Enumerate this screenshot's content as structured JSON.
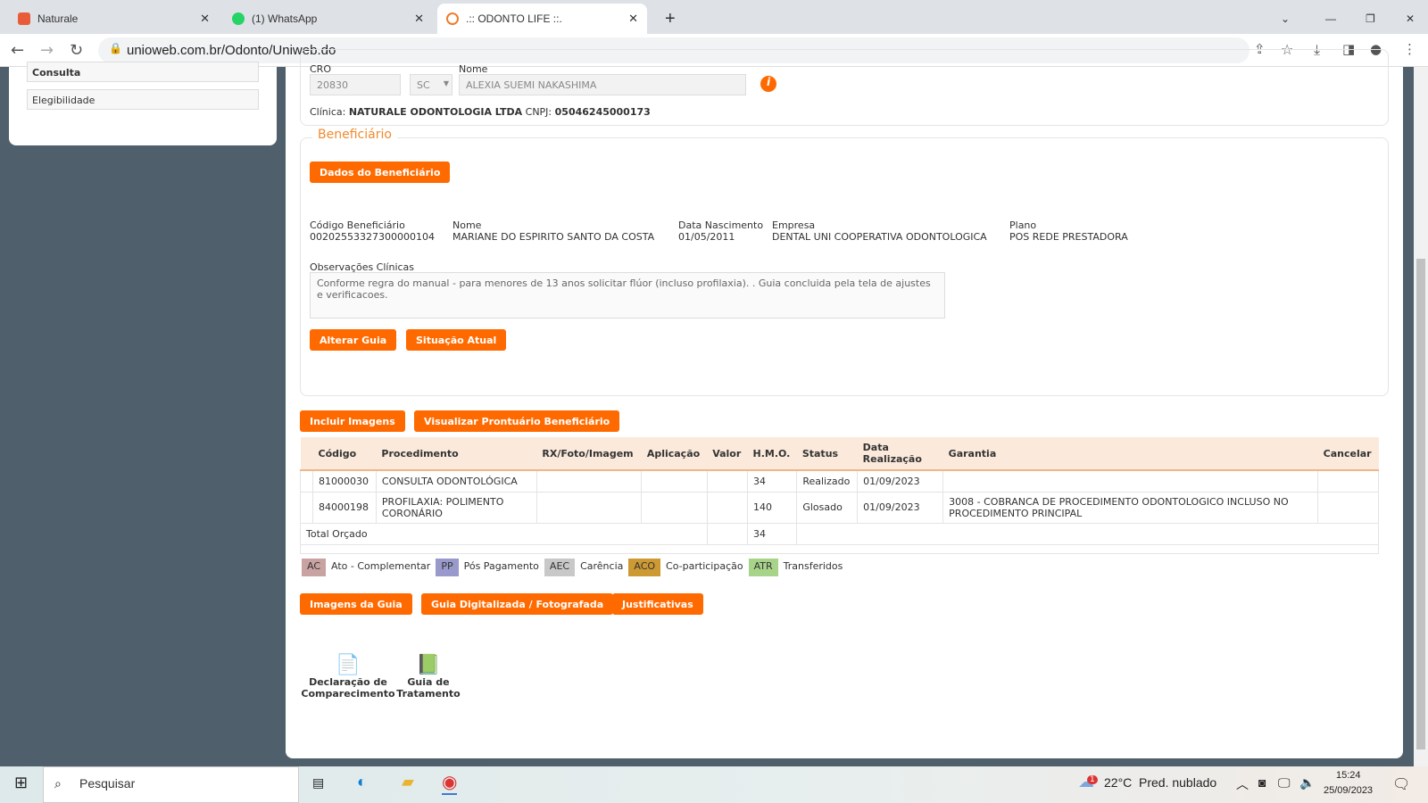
{
  "browser": {
    "tabs": [
      {
        "title": "Naturale"
      },
      {
        "title": "(1) WhatsApp"
      },
      {
        "title": ".:: ODONTO LIFE ::."
      }
    ],
    "url": "unioweb.com.br/Odonto/Uniweb.do"
  },
  "sidebar": {
    "items": [
      "Consulta",
      "Elegibilidade"
    ]
  },
  "dentist": {
    "cro_label": "CRO",
    "cro": "20830",
    "uf": "SC",
    "nome_label": "Nome",
    "nome": "ALEXIA SUEMI NAKASHIMA",
    "clinica_label": "Clínica:",
    "clinica": "NATURALE ODONTOLOGIA LTDA",
    "cnpj_label": "CNPJ:",
    "cnpj": "05046245000173"
  },
  "beneficiario": {
    "legend": "Beneficiário",
    "dados_button": "Dados do Beneficiário",
    "fields": [
      {
        "label": "Código Beneficiário",
        "value": "00202553327300000104"
      },
      {
        "label": "Nome",
        "value": "MARIANE DO ESPIRITO SANTO DA COSTA"
      },
      {
        "label": "Data Nascimento",
        "value": "01/05/2011"
      },
      {
        "label": "Empresa",
        "value": "DENTAL UNI COOPERATIVA ODONTOLOGICA"
      },
      {
        "label": "Plano",
        "value": "POS REDE PRESTADORA"
      }
    ],
    "obs_label": "Observações Clínicas",
    "obs": "Conforme regra do manual - para menores de 13 anos solicitar flúor (incluso profilaxia). . Guia concluida pela tela de ajustes e verificacoes.",
    "alterar": "Alterar Guia",
    "situacao": "Situação Atual"
  },
  "actions": {
    "incluir": "Incluir Imagens",
    "prontuario": "Visualizar Prontuário Beneficiário"
  },
  "table": {
    "headers": [
      "Código",
      "Procedimento",
      "RX/Foto/Imagem",
      "Aplicação",
      "Valor",
      "H.M.O.",
      "Status",
      "Data Realização",
      "Garantia",
      "Cancelar"
    ],
    "rows": [
      [
        "81000030",
        "CONSULTA ODONTOLÓGICA",
        "",
        "",
        "",
        "34",
        "Realizado",
        "01/09/2023",
        ""
      ],
      [
        "84000198",
        "PROFILAXIA: POLIMENTO CORONÁRIO",
        "",
        "",
        "",
        "140",
        "Glosado",
        "01/09/2023",
        "3008 - COBRANCA DE PROCEDIMENTO ODONTOLOGICO INCLUSO NO PROCEDIMENTO PRINCIPAL"
      ]
    ],
    "total_label": "Total Orçado",
    "total": "34"
  },
  "legend": [
    {
      "code": "AC",
      "label": "Ato - Complementar",
      "color": "#c9a2a2"
    },
    {
      "code": "PP",
      "label": "Pós Pagamento",
      "color": "#9999cc"
    },
    {
      "code": "AEC",
      "label": "Carência",
      "color": "#c8c8c8"
    },
    {
      "code": "ACO",
      "label": "Co-participação",
      "color": "#cc9933"
    },
    {
      "code": "ATR",
      "label": "Transferidos",
      "color": "#a8d48a"
    }
  ],
  "bottom": {
    "imagens": "Imagens da Guia",
    "digitalizada": "Guia Digitalizada / Fotografada",
    "justificativas": "Justificativas"
  },
  "docs": [
    {
      "label": "Declaração de Comparecimento"
    },
    {
      "label": "Guia de Tratamento"
    }
  ],
  "taskbar": {
    "search": "Pesquisar",
    "temp": "22°C",
    "weather": "Pred. nublado",
    "time": "15:24",
    "date": "25/09/2023",
    "badge": "1"
  }
}
